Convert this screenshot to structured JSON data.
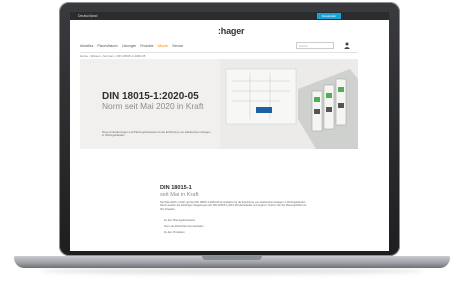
{
  "topbar": {
    "location": "Deutschland",
    "cta": "Newsletter"
  },
  "header": {
    "logo": ":hager",
    "search_placeholder": "Suche"
  },
  "nav": [
    {
      "label": "Aktuelles",
      "active": false
    },
    {
      "label": "Planen/bauen",
      "active": false
    },
    {
      "label": "Lösungen",
      "active": false
    },
    {
      "label": "Produkte",
      "active": false
    },
    {
      "label": "Wissen",
      "active": true
    },
    {
      "label": "Service",
      "active": false
    }
  ],
  "breadcrumb": "Home › Wissen › Normen › DIN 18015-1:2020-05",
  "hero": {
    "title": "DIN 18015-1:2020-05",
    "subtitle": "Norm seit Mai 2020 in Kraft",
    "description": "Neue Anforderungen und Planungshinweise für die Errichtung von elektrischen Anlagen in Wohngebäuden"
  },
  "article": {
    "title": "DIN 18015-1",
    "subtitle": "seit Mai in Kraft",
    "body": "Seit Mai 2020 in Kraft: gilt die DIN 18015-1:2020-05 Grundsätze für die Errichtung von elektrischen Anlagen in Wohngebäuden. Damit werden die bisherigen Regelungen der DIN 18015-1:2013-09 überarbeitet und ergänzt. Nutzen Sie die Planungshilfen für Ihre Projekte.",
    "links": [
      "Zu den Planungshinweisen",
      "Norm als Broschüre herunterladen",
      "Zu den Produkten"
    ]
  },
  "colors": {
    "accent": "#ff8c00",
    "cta": "#16a3da",
    "topbar": "#2b2c2e"
  }
}
